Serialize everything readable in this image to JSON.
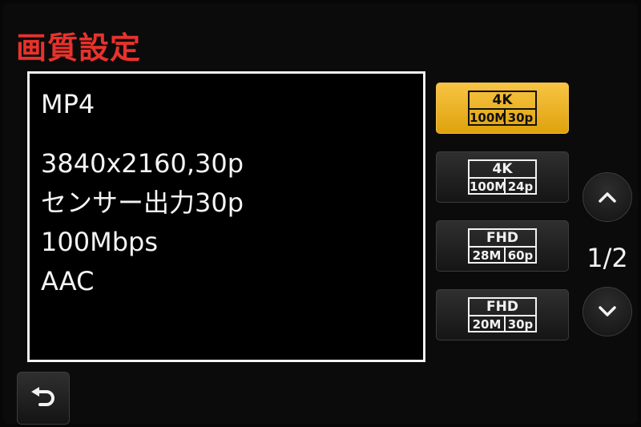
{
  "header": {
    "title": "画質設定"
  },
  "info": {
    "lines": [
      "MP4",
      "3840x2160,30p",
      "センサー出力30p",
      "100Mbps",
      "AAC"
    ]
  },
  "quality_options": [
    {
      "resolution": "4K",
      "bitrate": "100M",
      "fps": "30p",
      "selected": true
    },
    {
      "resolution": "4K",
      "bitrate": "100M",
      "fps": "24p",
      "selected": false
    },
    {
      "resolution": "FHD",
      "bitrate": "28M",
      "fps": "60p",
      "selected": false
    },
    {
      "resolution": "FHD",
      "bitrate": "20M",
      "fps": "30p",
      "selected": false
    }
  ],
  "pagination": {
    "indicator": "1/2"
  },
  "colors": {
    "title": "#e8322c",
    "selected_button": "#f0b429",
    "text": "#f4f4f4",
    "background": "#0b0b0b"
  },
  "icons": {
    "page_up": "chevron-up-icon",
    "page_down": "chevron-down-icon",
    "back": "return-arrow-icon"
  }
}
